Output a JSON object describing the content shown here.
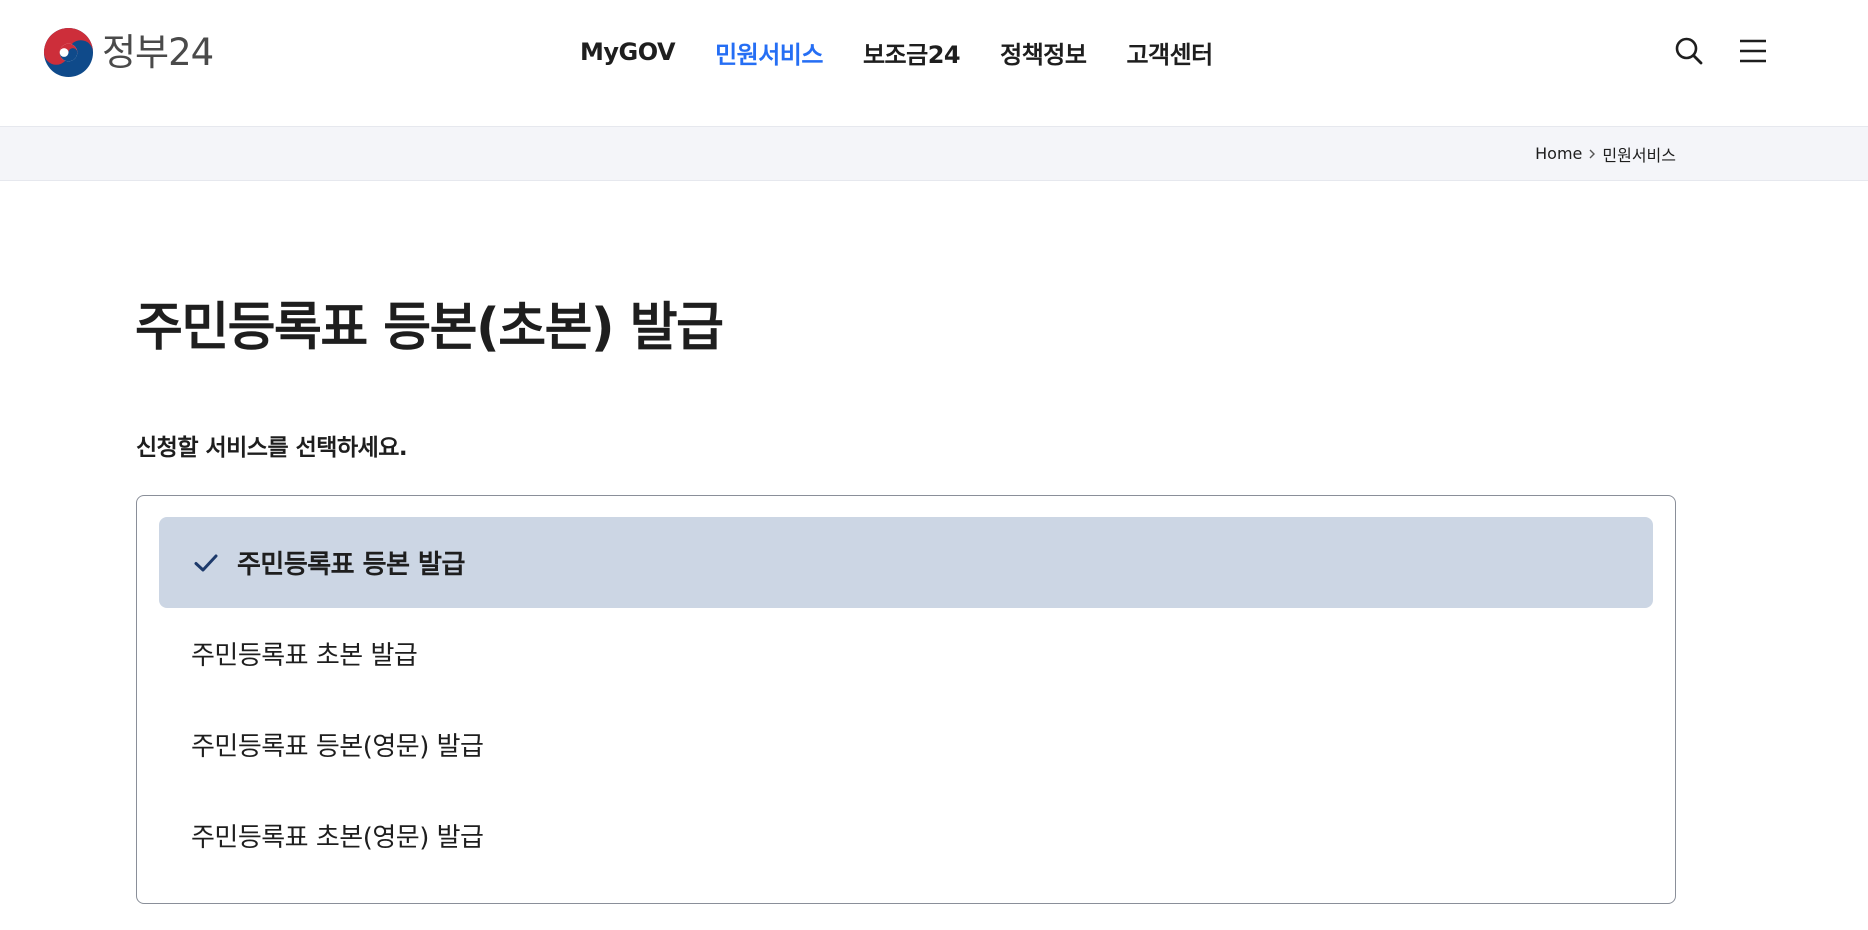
{
  "header": {
    "logo_text": "정부24",
    "nav": [
      {
        "label": "MyGOV",
        "active": false
      },
      {
        "label": "민원서비스",
        "active": true
      },
      {
        "label": "보조금24",
        "active": false
      },
      {
        "label": "정책정보",
        "active": false
      },
      {
        "label": "고객센터",
        "active": false
      }
    ],
    "icons": [
      "search-icon",
      "menu-icon"
    ]
  },
  "breadcrumb": {
    "items": [
      "Home",
      "민원서비스"
    ]
  },
  "main": {
    "title": "주민등록표 등본(초본) 발급",
    "instruction": "신청할 서비스를 선택하세요.",
    "options": [
      {
        "label": "주민등록표 등본 발급",
        "selected": true
      },
      {
        "label": "주민등록표 초본 발급",
        "selected": false
      },
      {
        "label": "주민등록표 등본(영문) 발급",
        "selected": false
      },
      {
        "label": "주민등록표 초본(영문) 발급",
        "selected": false
      }
    ]
  },
  "colors": {
    "accent": "#256ef4",
    "selected_bg": "#ccd6e4",
    "check": "#1d3a6b",
    "breadcrumb_bg": "#f4f5f9",
    "logo_red": "#cd2e3a",
    "logo_blue": "#0f4a8a"
  }
}
